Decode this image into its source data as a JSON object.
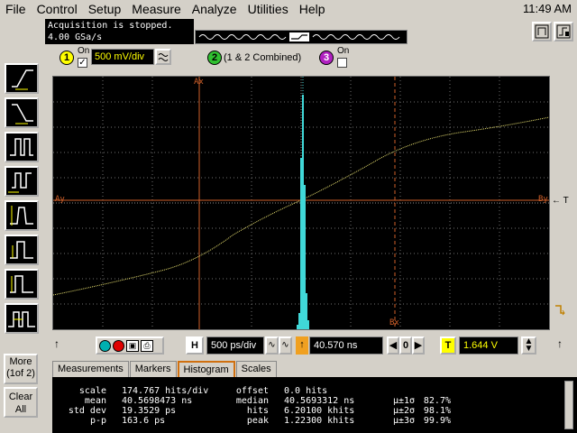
{
  "menu": [
    "File",
    "Control",
    "Setup",
    "Measure",
    "Analyze",
    "Utilities",
    "Help"
  ],
  "clock": "11:49 AM",
  "status": {
    "line1": "Acquisition is stopped.",
    "line2": "4.00 GSa/s"
  },
  "channels": {
    "ch1": {
      "num": "1",
      "on_label": "On",
      "volts": "500 mV/div",
      "checked": "✓"
    },
    "ch2": {
      "num": "2",
      "label": "(1 & 2 Combined)"
    },
    "ch3": {
      "num": "3",
      "on_label": "On"
    }
  },
  "toolbar": {
    "more_line1": "More",
    "more_line2": "(1of 2)",
    "clear_line1": "Clear",
    "clear_line2": "All"
  },
  "display": {
    "marker_ax": "Ax",
    "marker_bx": "Bx",
    "marker_ay": "Ay",
    "marker_by": "By",
    "trigger_label": "T"
  },
  "horizontal": {
    "h_label": "H",
    "timebase": "500 ps/div",
    "position": "40.570 ns",
    "zero": "0",
    "t_label": "T",
    "trigger_level": "1.644 V"
  },
  "tabs": [
    "Measurements",
    "Markers",
    "Histogram",
    "Scales"
  ],
  "results": {
    "col1_labels": [
      "scale",
      "mean",
      "std dev",
      "p-p"
    ],
    "col1_values": [
      "174.767 hits/div",
      "40.5698473 ns",
      "19.3529 ps",
      "163.6 ps"
    ],
    "col2_labels": [
      "offset",
      "median",
      "hits",
      "peak"
    ],
    "col2_values": [
      "0.0 hits",
      "40.5693312 ns",
      "6.20100 khits",
      "1.22300 khits"
    ],
    "col3_labels": [
      "µ±1σ",
      "µ±2σ",
      "µ±3σ"
    ],
    "col3_values": [
      "82.7%",
      "98.1%",
      "99.9%"
    ]
  },
  "colors": {
    "trace": "#e8e070",
    "histogram": "#40d8d8",
    "marker": "#d0602a",
    "grid": "#707070"
  }
}
